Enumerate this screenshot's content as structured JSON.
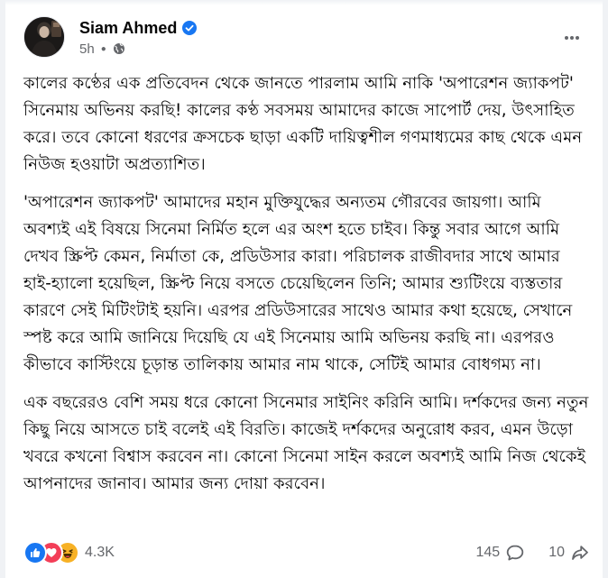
{
  "post": {
    "author": "Siam Ahmed",
    "time": "5h",
    "icons": {
      "verified": "verified-badge-icon",
      "audience": "globe-icon",
      "menu": "more-horizontal-icon"
    },
    "paragraphs": [
      "কালের কণ্ঠের এক প্রতিবেদন থেকে জানতে পারলাম আমি নাকি 'অপারেশন জ্যাকপট' সিনেমায় অভিনয় করছি! কালের কণ্ঠ সবসময় আমাদের কাজে সাপোর্ট দেয়, উৎসাহিত করে।  তবে কোনো ধরণের ক্রসচেক ছাড়া একটি দায়িত্বশীল গণমাধ্যমের কাছ থেকে এমন নিউজ হওয়াটা অপ্রত্যাশিত।",
      "'অপারেশন জ্যাকপট' আমাদের মহান মুক্তিযুদ্ধের অন্যতম গৌরবের জায়গা। আমি অবশ্যই এই বিষয়ে সিনেমা নির্মিত হলে এর অংশ হতে চাইব। কিন্তু সবার আগে আমি দেখব স্ক্রিপ্ট কেমন, নির্মাতা কে, প্রডিউসার কারা। পরিচালক রাজীবদার সাথে আমার হাই-হ্যালো হয়েছিল, স্ক্রিপ্ট নিয়ে বসতে চেয়েছিলেন তিনি; আমার শ্যুটিংয়ে ব্যস্ততার কারণে সেই মিটিংটাই হয়নি। এরপর প্রডিউসারের সাথেও আমার কথা হয়েছে, সেখানে স্পষ্ট করে আমি জানিয়ে দিয়েছি যে এই সিনেমায় আমি অভিনয় করছি না। এরপরও কীভাবে কাস্টিংয়ে চূড়ান্ত তালিকায় আমার নাম থাকে, সেটিই আমার বোধগম্য না।",
      "এক বছরেরও বেশি সময় ধরে কোনো সিনেমার সাইনিং করিনি আমি। দর্শকদের জন্য নতুন কিছু নিয়ে আসতে চাই বলেই এই বিরতি। কাজেই দর্শকদের অনুরোধ করব, এমন উড়ো খবরে কখনো বিশ্বাস করবেন না। কোনো সিনেমা সাইন করলে অবশ্যই আমি নিজ থেকেই আপনাদের জানাব। আমার জন্য দোয়া করবেন।"
    ]
  },
  "reactions": {
    "types": [
      "like-icon",
      "love-icon",
      "haha-icon"
    ],
    "count": "4.3K",
    "comments": "145",
    "shares": "10",
    "colors": {
      "like": "#1877f2",
      "love": "#f33e58",
      "haha": "#f7b125",
      "verified": "#1877f2",
      "secondary_text": "#65676b"
    }
  }
}
